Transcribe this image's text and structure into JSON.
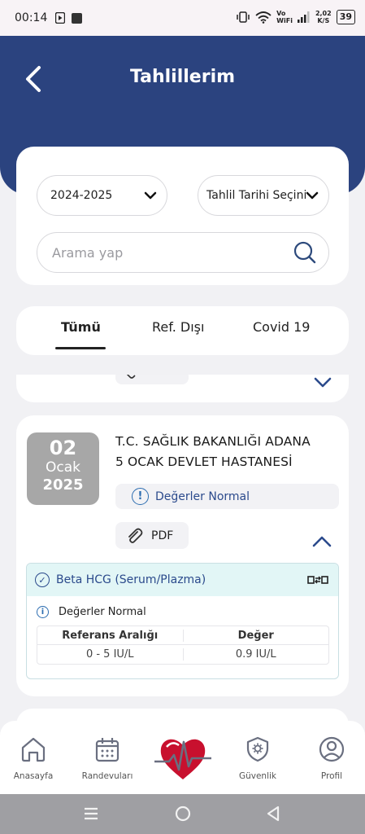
{
  "status_bar": {
    "time": "00:14",
    "network_label_top": "Vo",
    "network_label_bottom": "WiFi",
    "speed_top": "2,02",
    "speed_bottom": "K/S",
    "battery": "39"
  },
  "header": {
    "title": "Tahlillerim",
    "back_icon": "chevron-left-icon",
    "background": "#2b437f"
  },
  "filters": {
    "year_value": "2024-2025",
    "date_value": "Tahlil Tarihi Seçiniz",
    "search_placeholder": "Arama yap"
  },
  "tabs": [
    {
      "label": "Tümü",
      "active": true
    },
    {
      "label": "Ref. Dışı",
      "active": false
    },
    {
      "label": "Covid 19",
      "active": false
    }
  ],
  "result": {
    "day": "02",
    "month": "Ocak",
    "year": "2025",
    "hospital_line1": "T.C. SAĞLIK BAKANLIĞI ADANA",
    "hospital_line2": "5 OCAK DEVLET HASTANESİ",
    "status": "Değerler Normal",
    "status_icon_glyph": "!",
    "pdf_label": "PDF",
    "test": {
      "name": "Beta HCG (Serum/Plazma)",
      "status": "Değerler Normal",
      "check_glyph": "✓",
      "info_glyph": "i",
      "columns": [
        "Referans Aralığı",
        "Değer"
      ],
      "reference_range": "0 - 5 IU/L",
      "value": "0.9 IU/L"
    }
  },
  "bottom_nav": [
    {
      "label": "Anasayfa",
      "icon": "home-icon"
    },
    {
      "label": "Randevuları",
      "icon": "calendar-icon"
    },
    {
      "label": "",
      "icon": "heart-logo-icon"
    },
    {
      "label": "Güvenlik",
      "icon": "shield-gear-icon"
    },
    {
      "label": "Profil",
      "icon": "profile-icon"
    }
  ],
  "colors": {
    "accent": "#2b437f",
    "status_text": "#2b4a8c",
    "test_header_bg": "#e2f6f6",
    "date_box": "#a7a7a7",
    "logo_red": "#c8102e"
  }
}
